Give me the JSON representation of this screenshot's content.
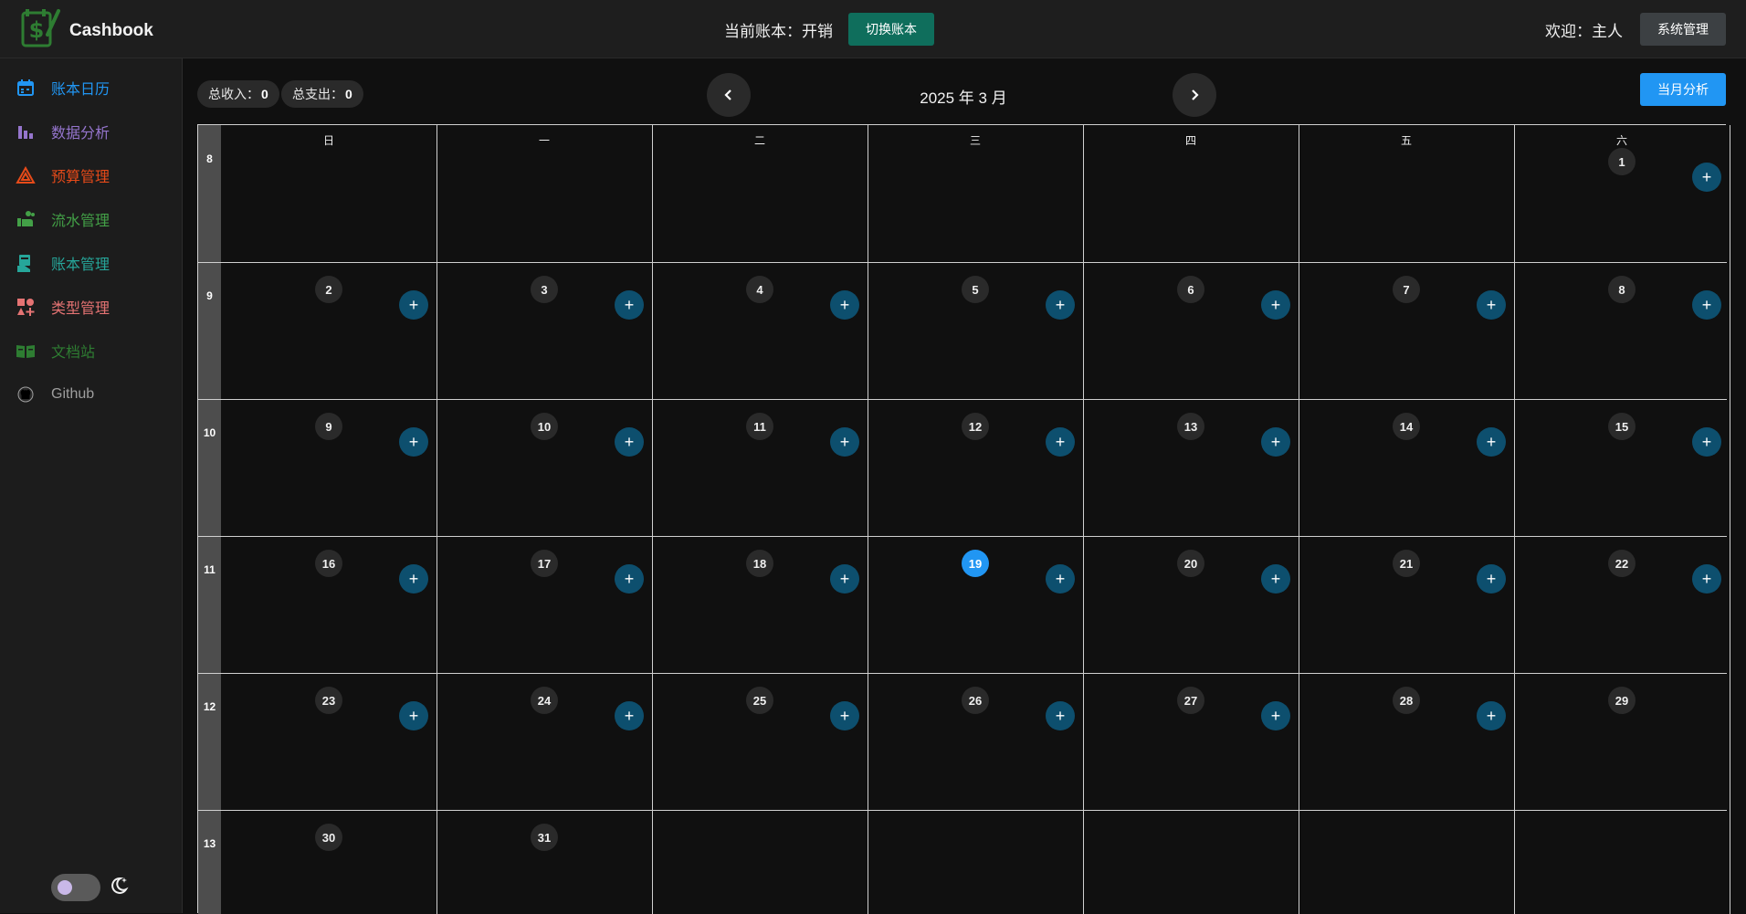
{
  "header": {
    "brand": "Cashbook",
    "current_book": "当前账本：开销",
    "switch_label": "切换账本",
    "welcome": "欢迎：主人",
    "system_label": "系统管理"
  },
  "sidebar": {
    "items": [
      {
        "label": "账本日历",
        "icon": "calendar-icon",
        "color": "#2196f3"
      },
      {
        "label": "数据分析",
        "icon": "bar-chart-icon",
        "color": "#9575cd"
      },
      {
        "label": "预算管理",
        "icon": "triangle-icon",
        "color": "#e64a19"
      },
      {
        "label": "流水管理",
        "icon": "hand-coin-icon",
        "color": "#43a047"
      },
      {
        "label": "账本管理",
        "icon": "book-hand-icon",
        "color": "#26a69a"
      },
      {
        "label": "类型管理",
        "icon": "shapes-icon",
        "color": "#e57373"
      },
      {
        "label": "文档站",
        "icon": "book-open-icon",
        "color": "#2e7d32"
      },
      {
        "label": "Github",
        "icon": "github-icon",
        "color": "#9e9e9e"
      }
    ]
  },
  "summary": {
    "income_label": "总收入：",
    "income_value": "0",
    "expense_label": "总支出：",
    "expense_value": "0"
  },
  "calendar": {
    "title": "2025 年 3 月",
    "analysis_label": "当月分析",
    "weekdays": [
      "日",
      "一",
      "二",
      "三",
      "四",
      "五",
      "六"
    ],
    "today": 19,
    "weeks": [
      {
        "num": "8",
        "days": [
          null,
          null,
          null,
          null,
          null,
          null,
          1
        ]
      },
      {
        "num": "9",
        "days": [
          2,
          3,
          4,
          5,
          6,
          7,
          8
        ]
      },
      {
        "num": "10",
        "days": [
          9,
          10,
          11,
          12,
          13,
          14,
          15
        ]
      },
      {
        "num": "11",
        "days": [
          16,
          17,
          18,
          19,
          20,
          21,
          22
        ]
      },
      {
        "num": "12",
        "days": [
          23,
          24,
          25,
          26,
          27,
          28,
          29
        ]
      },
      {
        "num": "13",
        "days": [
          30,
          31,
          null,
          null,
          null,
          null,
          null
        ]
      }
    ],
    "add_label": "+",
    "no_add_days": [
      29,
      30,
      31
    ]
  },
  "theme": {
    "accent": "#2196f3",
    "add_button": "#0d4f6e"
  }
}
